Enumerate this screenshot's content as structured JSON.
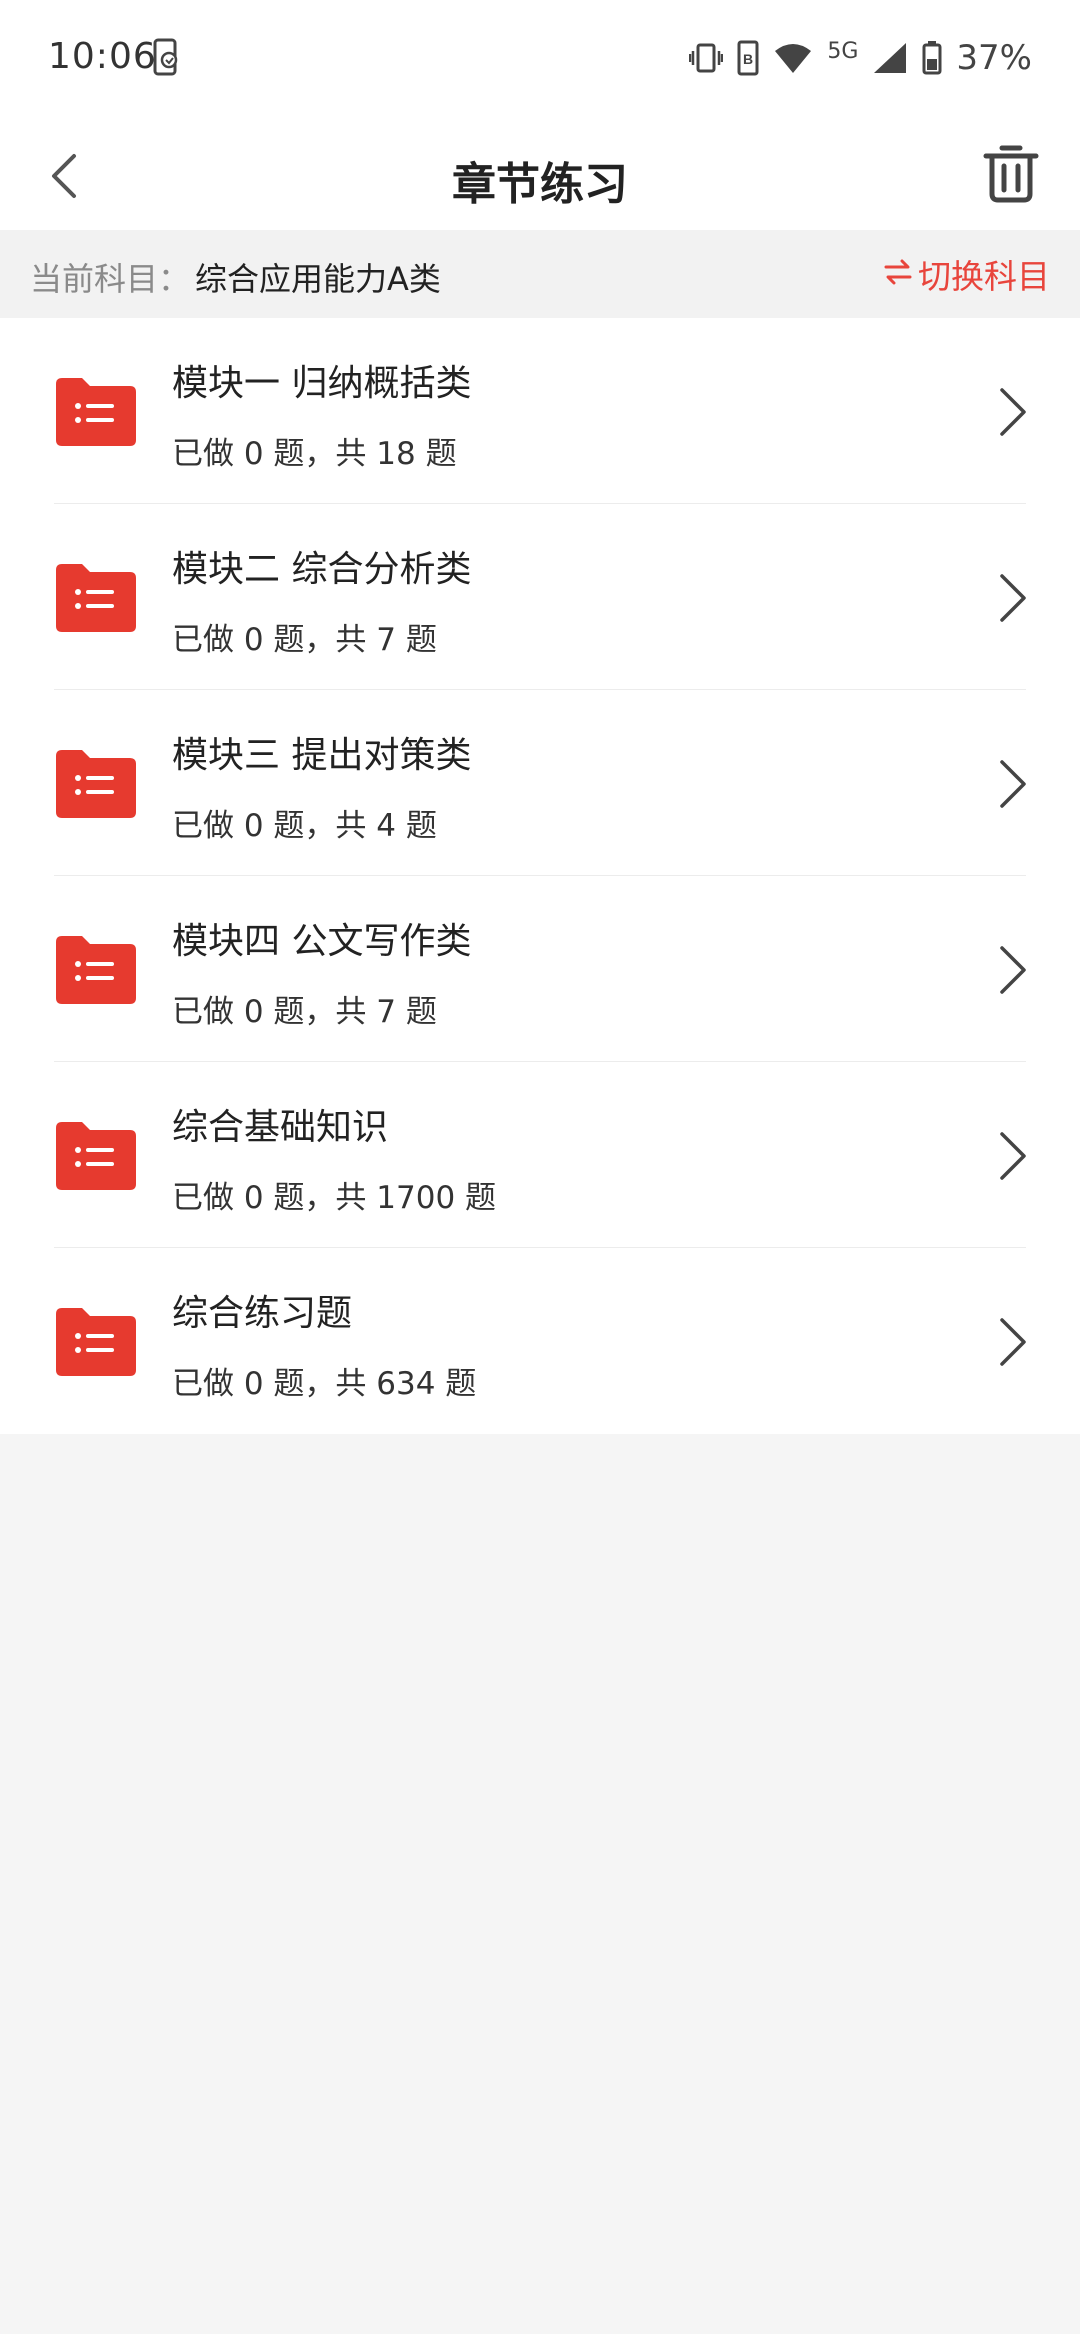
{
  "status_bar": {
    "time": "10:06",
    "network": "5G",
    "battery": "37%"
  },
  "nav": {
    "title": "章节练习",
    "back_icon": "chevron-left-icon",
    "trash_icon": "trash-icon"
  },
  "subject": {
    "label": "当前科目：",
    "value": "综合应用能力A类",
    "switch_label": "切换科目",
    "switch_icon": "swap-arrows-icon"
  },
  "colors": {
    "accent": "#e8453c",
    "background": "#f5f5f5"
  },
  "chapters": [
    {
      "title": "模块一 归纳概括类",
      "progress": "已做 0 题，共 18 题"
    },
    {
      "title": "模块二 综合分析类",
      "progress": "已做 0 题，共 7 题"
    },
    {
      "title": "模块三 提出对策类",
      "progress": "已做 0 题，共 4 题"
    },
    {
      "title": "模块四 公文写作类",
      "progress": "已做 0 题，共 7 题"
    },
    {
      "title": "综合基础知识",
      "progress": "已做 0 题，共 1700 题"
    },
    {
      "title": "综合练习题",
      "progress": "已做 0 题，共 634 题"
    }
  ]
}
